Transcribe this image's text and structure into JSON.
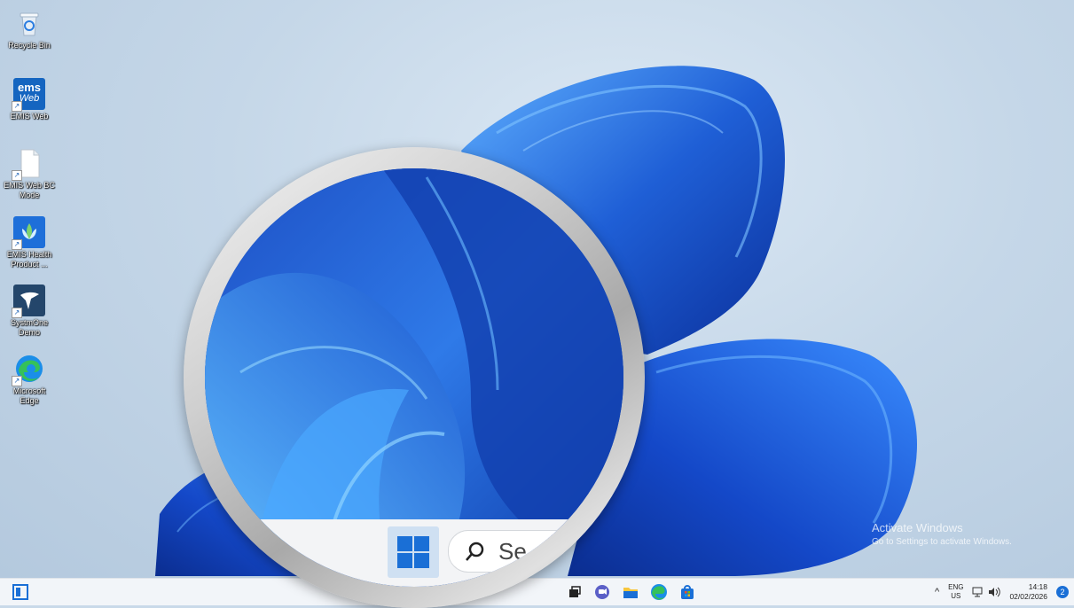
{
  "desktop": {
    "icons": [
      {
        "label": "Recycle Bin",
        "icon": "recycle-bin-icon"
      },
      {
        "label": "EMIS Web",
        "icon": "emis-web-icon"
      },
      {
        "label": "EMIS Web BC Mode",
        "icon": "document-icon"
      },
      {
        "label": "EMIS Health Product ...",
        "icon": "emis-health-icon"
      },
      {
        "label": "SystmOne Demo",
        "icon": "systmone-icon"
      },
      {
        "label": "Microsoft Edge",
        "icon": "edge-icon"
      }
    ],
    "emis_logo_text": [
      "ems",
      "Web"
    ]
  },
  "watermark": {
    "line1": "Activate Windows",
    "line2": "Go to Settings to activate Windows."
  },
  "magnifier": {
    "search_text": "Se"
  },
  "taskbar": {
    "tray": {
      "lang_top": "ENG",
      "lang_bottom": "US",
      "time": "14:18",
      "date": "02/02/2026",
      "notification_count": "2"
    }
  },
  "colors": {
    "accent": "#1a6fd6",
    "wallpaper_blue": "#1f5fd6",
    "taskbar_bg": "#f2f5f9"
  }
}
